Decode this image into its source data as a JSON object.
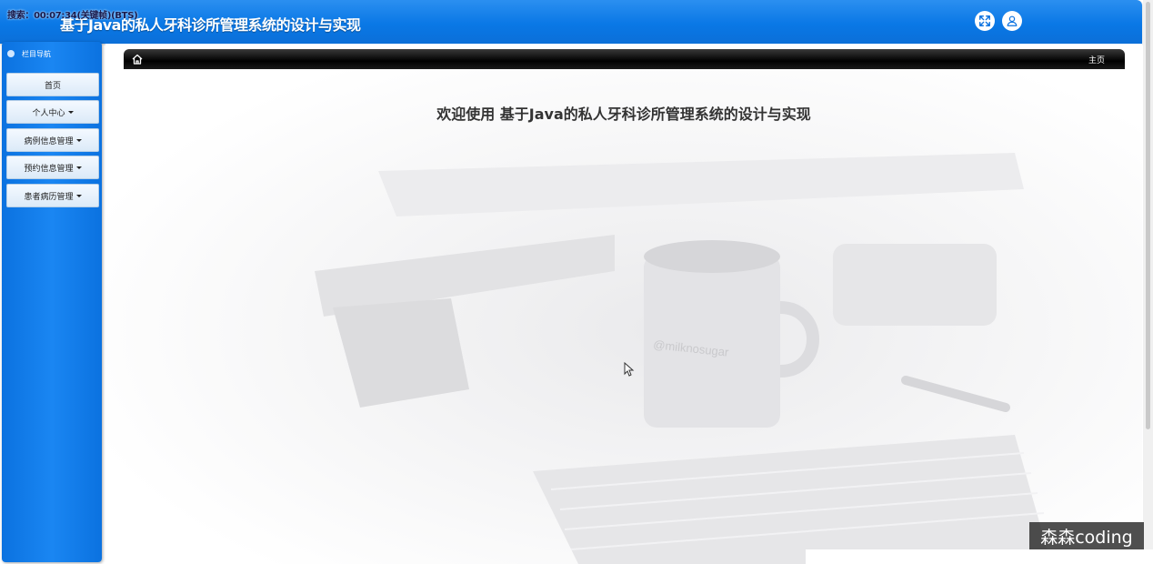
{
  "recording": {
    "label": "搜索：00:07:34(关键帧)(BTS)"
  },
  "header": {
    "title": "基于Java的私人牙科诊所管理系统的设计与实现",
    "fullscreen_icon": "fullscreen-icon",
    "user_icon": "user-icon",
    "background": "#0a78e6"
  },
  "sidebar": {
    "heading": "栏目导航",
    "items": [
      {
        "label": "首页",
        "has_caret": false
      },
      {
        "label": "个人中心",
        "has_caret": true
      },
      {
        "label": "病例信息管理",
        "has_caret": true
      },
      {
        "label": "预约信息管理",
        "has_caret": true
      },
      {
        "label": "患者病历管理",
        "has_caret": true
      }
    ],
    "background": "#1a86f2"
  },
  "breadcrumb": {
    "home_icon": "home-icon",
    "current": "主页"
  },
  "main": {
    "welcome": "欢迎使用 基于Java的私人牙科诊所管理系统的设计与实现",
    "mug_text": "@milknosugar"
  },
  "watermark": {
    "text": "森森coding"
  }
}
